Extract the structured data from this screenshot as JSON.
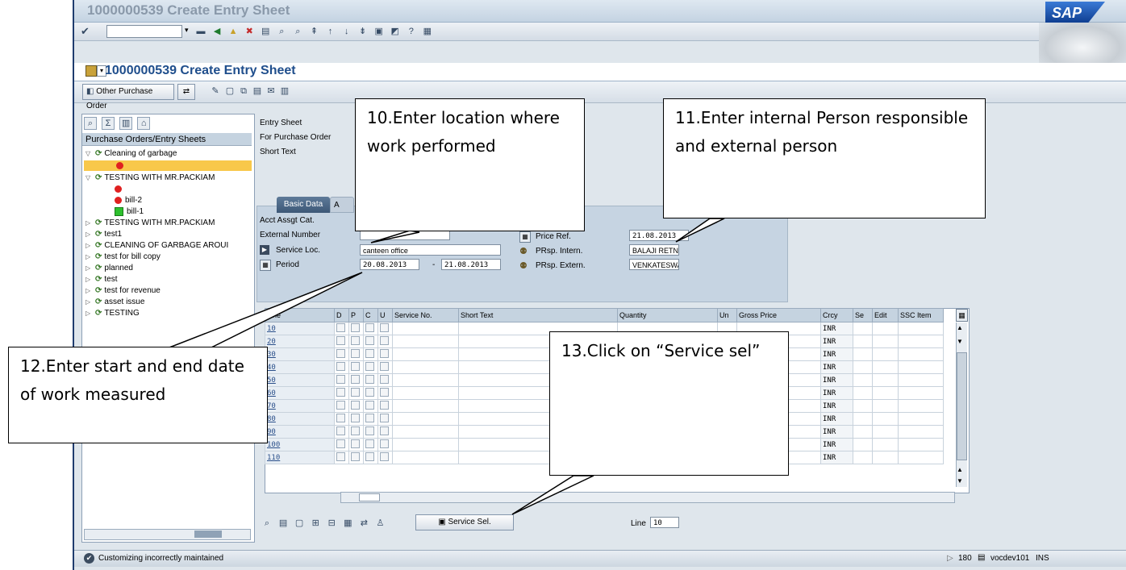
{
  "window": {
    "title": "1000000539 Create Entry Sheet",
    "logo": "SAP"
  },
  "screen": {
    "title": "1000000539 Create Entry Sheet"
  },
  "toolbar": {
    "other_po_label": "Other Purchase Order"
  },
  "nav": {
    "header": "Purchase Orders/Entry Sheets",
    "items": [
      {
        "label": "Cleaning of garbage",
        "state": "expanded"
      },
      {
        "label": "",
        "state": "red"
      },
      {
        "label": "TESTING WITH MR.PACKIAM",
        "state": "expanded"
      },
      {
        "label": "",
        "state": "red"
      },
      {
        "label": "bill-2",
        "state": "red"
      },
      {
        "label": "bill-1",
        "state": "green"
      },
      {
        "label": "TESTING WITH MR.PACKIAM",
        "state": "collapsed"
      },
      {
        "label": "test1",
        "state": "collapsed"
      },
      {
        "label": "CLEANING OF GARBAGE AROUI",
        "state": "collapsed"
      },
      {
        "label": "test for bill copy",
        "state": "collapsed"
      },
      {
        "label": "planned",
        "state": "collapsed"
      },
      {
        "label": "test",
        "state": "collapsed"
      },
      {
        "label": "test for revenue",
        "state": "collapsed"
      },
      {
        "label": "asset issue",
        "state": "collapsed"
      },
      {
        "label": "TESTING",
        "state": "collapsed"
      }
    ]
  },
  "header_fields": {
    "entry_sheet": "Entry Sheet",
    "for_po": "For Purchase Order",
    "short_text": "Short Text"
  },
  "tabs": {
    "basic_data": "Basic Data",
    "second": "A"
  },
  "form": {
    "acct_assgt_label": "Acct Assgt Cat.",
    "external_number_label": "External Number",
    "service_loc_label": "Service Loc.",
    "service_loc_value": "canteen office",
    "period_label": "Period",
    "period_from": "20.08.2013",
    "period_sep": "-",
    "period_to": "21.08.2013",
    "price_ref_label": "Price Ref.",
    "price_ref_value": "21.08.2013",
    "prsp_intern_label": "PRsp. Intern.",
    "prsp_intern_value": "BALAJI RETNA",
    "prsp_extern_label": "PRsp. Extern.",
    "prsp_extern_value": "VENKATESWAR"
  },
  "table": {
    "columns": [
      "Line",
      "D",
      "P",
      "C",
      "U",
      "Service No.",
      "Short Text",
      "Quantity",
      "Un",
      "Gross Price",
      "Crcy",
      "Se",
      "Edit",
      "SSC Item"
    ],
    "rows": [
      {
        "line": "10",
        "crcy": "INR"
      },
      {
        "line": "20",
        "crcy": "INR"
      },
      {
        "line": "30",
        "crcy": "INR"
      },
      {
        "line": "40",
        "crcy": "INR"
      },
      {
        "line": "50",
        "crcy": "INR"
      },
      {
        "line": "60",
        "crcy": "INR"
      },
      {
        "line": "70",
        "crcy": "INR"
      },
      {
        "line": "80",
        "crcy": "INR"
      },
      {
        "line": "90",
        "crcy": "INR"
      },
      {
        "line": "100",
        "crcy": "INR"
      },
      {
        "line": "110",
        "crcy": "INR"
      }
    ]
  },
  "bottom": {
    "service_sel_label": "Service Sel.",
    "line_label": "Line",
    "line_value": "10"
  },
  "status": {
    "message": "Customizing incorrectly maintained",
    "session": "180",
    "server": "vocdev101",
    "mode": "INS"
  },
  "callouts": {
    "c10": "10.Enter location where work performed",
    "c11": "11.Enter internal Person responsible and external person",
    "c12": "12.Enter start and end date of work measured",
    "c13": "13.Click on “Service sel”"
  },
  "icons": [
    "check-icon",
    "save-icon",
    "back-icon",
    "exit-icon",
    "cancel-icon",
    "print-icon",
    "find-icon",
    "help-icon",
    "shield-icon",
    "checkbox-icon",
    "other-po-icon",
    "create-icon",
    "copy-icon",
    "list-icon",
    "settings-icon",
    "hide-icon"
  ]
}
